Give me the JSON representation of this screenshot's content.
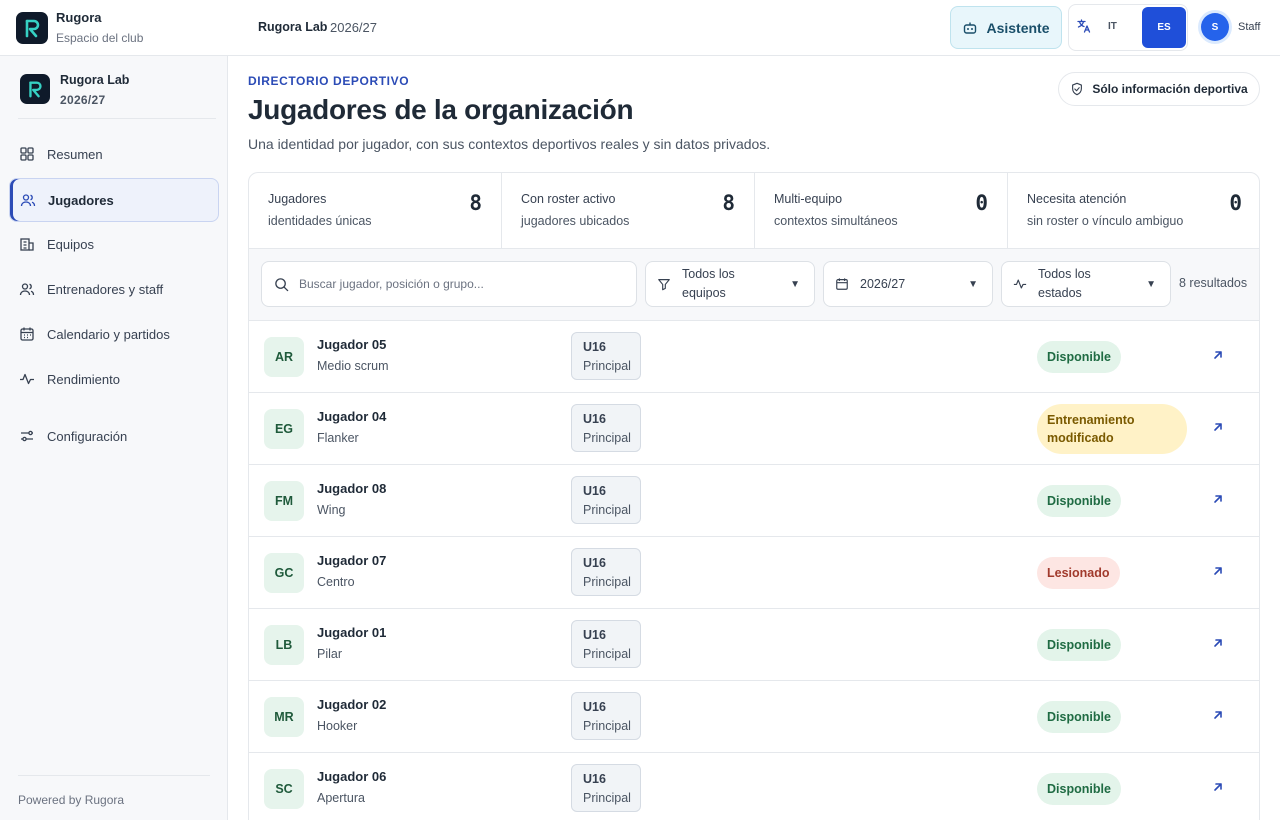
{
  "topbar": {
    "brand_name": "Rugora",
    "brand_sub": "Espacio del club",
    "org": "Rugora Lab",
    "season": "2026/27",
    "assistant_label": "Asistente",
    "lang_it": "IT",
    "lang_es": "ES",
    "user_initial": "S",
    "user_name": "Staff"
  },
  "sidebar": {
    "org": "Rugora Lab",
    "season": "2026/27",
    "items": [
      {
        "label": "Resumen",
        "icon": "grid-icon"
      },
      {
        "label": "Jugadores",
        "icon": "users-icon",
        "active": true
      },
      {
        "label": "Equipos",
        "icon": "building-icon"
      },
      {
        "label": "Entrenadores y staff",
        "icon": "users-icon"
      },
      {
        "label": "Calendario y partidos",
        "icon": "calendar-icon"
      },
      {
        "label": "Rendimiento",
        "icon": "activity-icon"
      },
      {
        "label": "Configuración",
        "icon": "sliders-icon"
      }
    ],
    "footer": "Powered by Rugora"
  },
  "page": {
    "eyebrow": "DIRECTORIO DEPORTIVO",
    "title": "Jugadores de la organización",
    "subtitle": "Una identidad por jugador, con sus contextos deportivos reales y sin datos privados.",
    "chip": "Sólo información deportiva"
  },
  "stats": [
    {
      "label": "Jugadores",
      "sub": "identidades únicas",
      "value": "8"
    },
    {
      "label": "Con roster activo",
      "sub": "jugadores ubicados",
      "value": "8"
    },
    {
      "label": "Multi-equipo",
      "sub": "contextos simultáneos",
      "value": "0"
    },
    {
      "label": "Necesita atención",
      "sub": "sin roster o vínculo ambiguo",
      "value": "0"
    }
  ],
  "filters": {
    "search_placeholder": "Buscar jugador, posición o grupo...",
    "team_line1": "Todos los",
    "team_line2": "equipos",
    "season": "2026/27",
    "status_line1": "Todos los",
    "status_line2": "estados",
    "results": "8 resultados"
  },
  "players": [
    {
      "initials": "AR",
      "name": "Jugador 05",
      "position": "Medio scrum",
      "team": "U16",
      "role": "Principal",
      "status": "Disponible",
      "status_type": "ok"
    },
    {
      "initials": "EG",
      "name": "Jugador 04",
      "position": "Flanker",
      "team": "U16",
      "role": "Principal",
      "status": "Entrenamiento modificado",
      "status_type": "warn"
    },
    {
      "initials": "FM",
      "name": "Jugador 08",
      "position": "Wing",
      "team": "U16",
      "role": "Principal",
      "status": "Disponible",
      "status_type": "ok"
    },
    {
      "initials": "GC",
      "name": "Jugador 07",
      "position": "Centro",
      "team": "U16",
      "role": "Principal",
      "status": "Lesionado",
      "status_type": "bad"
    },
    {
      "initials": "LB",
      "name": "Jugador 01",
      "position": "Pilar",
      "team": "U16",
      "role": "Principal",
      "status": "Disponible",
      "status_type": "ok"
    },
    {
      "initials": "MR",
      "name": "Jugador 02",
      "position": "Hooker",
      "team": "U16",
      "role": "Principal",
      "status": "Disponible",
      "status_type": "ok"
    },
    {
      "initials": "SC",
      "name": "Jugador 06",
      "position": "Apertura",
      "team": "U16",
      "role": "Principal",
      "status": "Disponible",
      "status_type": "ok"
    }
  ],
  "colors": {
    "accent": "#2b4bb6",
    "lang_active": "#1f4fd9",
    "ok": "#1f6b43",
    "warn": "#7a5a00",
    "bad": "#a13a2c"
  }
}
